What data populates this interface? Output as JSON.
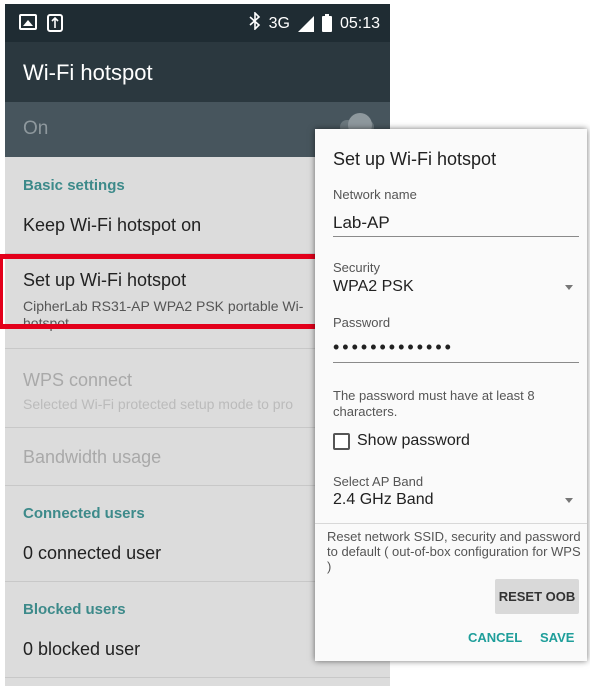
{
  "status_bar": {
    "left_icons": [
      "image-icon",
      "usb-icon"
    ],
    "right_icons": [
      "bluetooth-icon",
      "signal-icon",
      "battery-icon"
    ],
    "network": "3G",
    "time": "05:13"
  },
  "app_bar": {
    "title": "Wi-Fi hotspot"
  },
  "master_switch": {
    "label": "On",
    "state": "on"
  },
  "sections": {
    "basic_settings": "Basic settings",
    "connected_users": "Connected users",
    "blocked_users": "Blocked users"
  },
  "items": {
    "keep_on": "Keep Wi-Fi hotspot on",
    "setup_title": "Set up Wi-Fi hotspot",
    "setup_subtitle_line1": "CipherLab RS31-AP WPA2 PSK portable Wi-",
    "setup_subtitle_line2": "hotspot",
    "wps_title": "WPS connect",
    "wps_subtitle": "Selected Wi-Fi protected setup mode to pro",
    "bandwidth": "Bandwidth usage",
    "connected_count": "0 connected user",
    "blocked_count": "0 blocked user"
  },
  "highlight_color": "#e3001b",
  "dialog": {
    "title": "Set up Wi-Fi hotspot",
    "network_name_label": "Network name",
    "network_name_value": "Lab-AP",
    "security_label": "Security",
    "security_value": "WPA2 PSK",
    "password_label": "Password",
    "password_mask": "•••••••••••••",
    "password_hint": "The password must have at least 8 characters.",
    "show_password": "Show password",
    "show_password_checked": false,
    "ap_band_label": "Select AP Band",
    "ap_band_value": "2.4 GHz Band",
    "reset_note": "Reset network SSID, security and password to default ( out-of-box configuration for WPS )",
    "reset_button": "RESET OOB",
    "cancel_button": "CANCEL",
    "save_button": "SAVE",
    "accent_color": "#1e9e9a"
  }
}
